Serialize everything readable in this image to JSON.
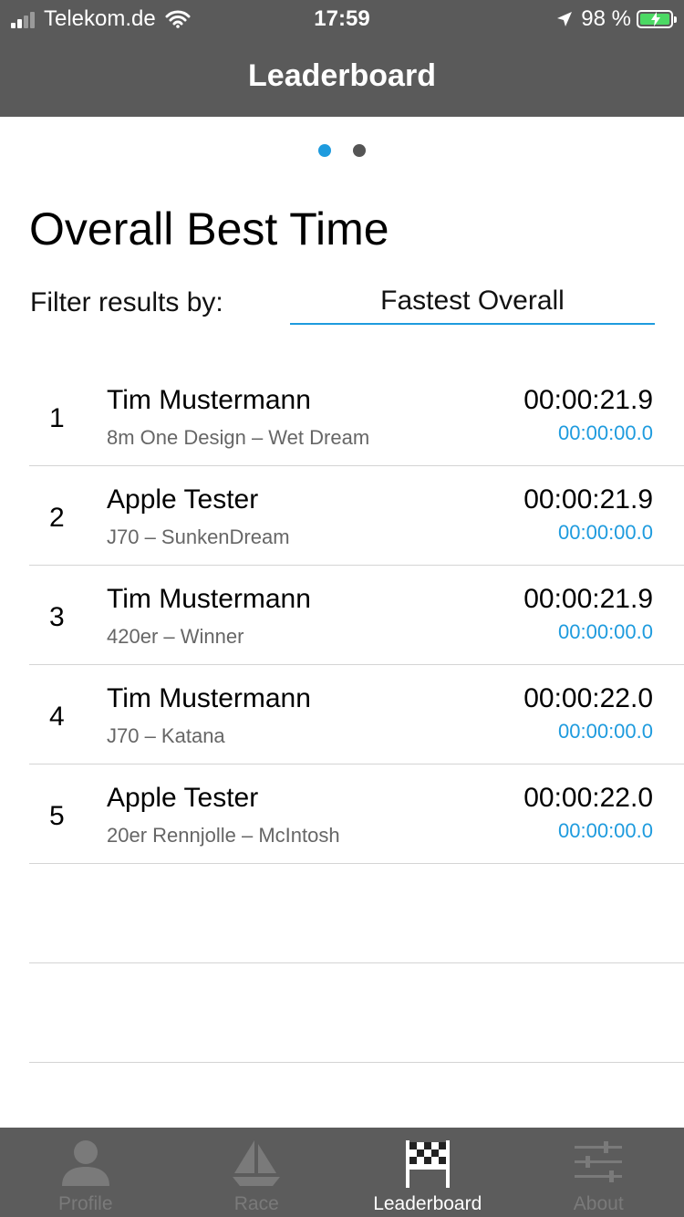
{
  "status_bar": {
    "carrier": "Telekom.de",
    "time": "17:59",
    "battery_percent": "98 %"
  },
  "nav": {
    "title": "Leaderboard"
  },
  "pager": {
    "pages": 2,
    "active_index": 0
  },
  "heading": "Overall Best Time",
  "filter": {
    "label": "Filter results by:",
    "value": "Fastest Overall"
  },
  "rows": [
    {
      "rank": "1",
      "name": "Tim Mustermann",
      "boat": "8m One Design – Wet Dream",
      "time": "00:00:21.9",
      "delta": "00:00:00.0"
    },
    {
      "rank": "2",
      "name": "Apple Tester",
      "boat": "J70 – SunkenDream",
      "time": "00:00:21.9",
      "delta": "00:00:00.0"
    },
    {
      "rank": "3",
      "name": "Tim Mustermann",
      "boat": "420er – Winner",
      "time": "00:00:21.9",
      "delta": "00:00:00.0"
    },
    {
      "rank": "4",
      "name": "Tim Mustermann",
      "boat": "J70 – Katana",
      "time": "00:00:22.0",
      "delta": "00:00:00.0"
    },
    {
      "rank": "5",
      "name": "Apple Tester",
      "boat": "20er Rennjolle – McIntosh",
      "time": "00:00:22.0",
      "delta": "00:00:00.0"
    },
    {
      "rank": "",
      "name": "",
      "boat": "",
      "time": "",
      "delta": ""
    },
    {
      "rank": "",
      "name": "",
      "boat": "",
      "time": "",
      "delta": ""
    }
  ],
  "tabs": [
    {
      "label": "Profile",
      "icon": "profile-icon",
      "active": false
    },
    {
      "label": "Race",
      "icon": "sailboat-icon",
      "active": false
    },
    {
      "label": "Leaderboard",
      "icon": "checkered-flag-icon",
      "active": true
    },
    {
      "label": "About",
      "icon": "sliders-icon",
      "active": false
    }
  ],
  "colors": {
    "accent": "#1e9bde",
    "bar": "#5a5a5a",
    "battery": "#4cd964"
  }
}
